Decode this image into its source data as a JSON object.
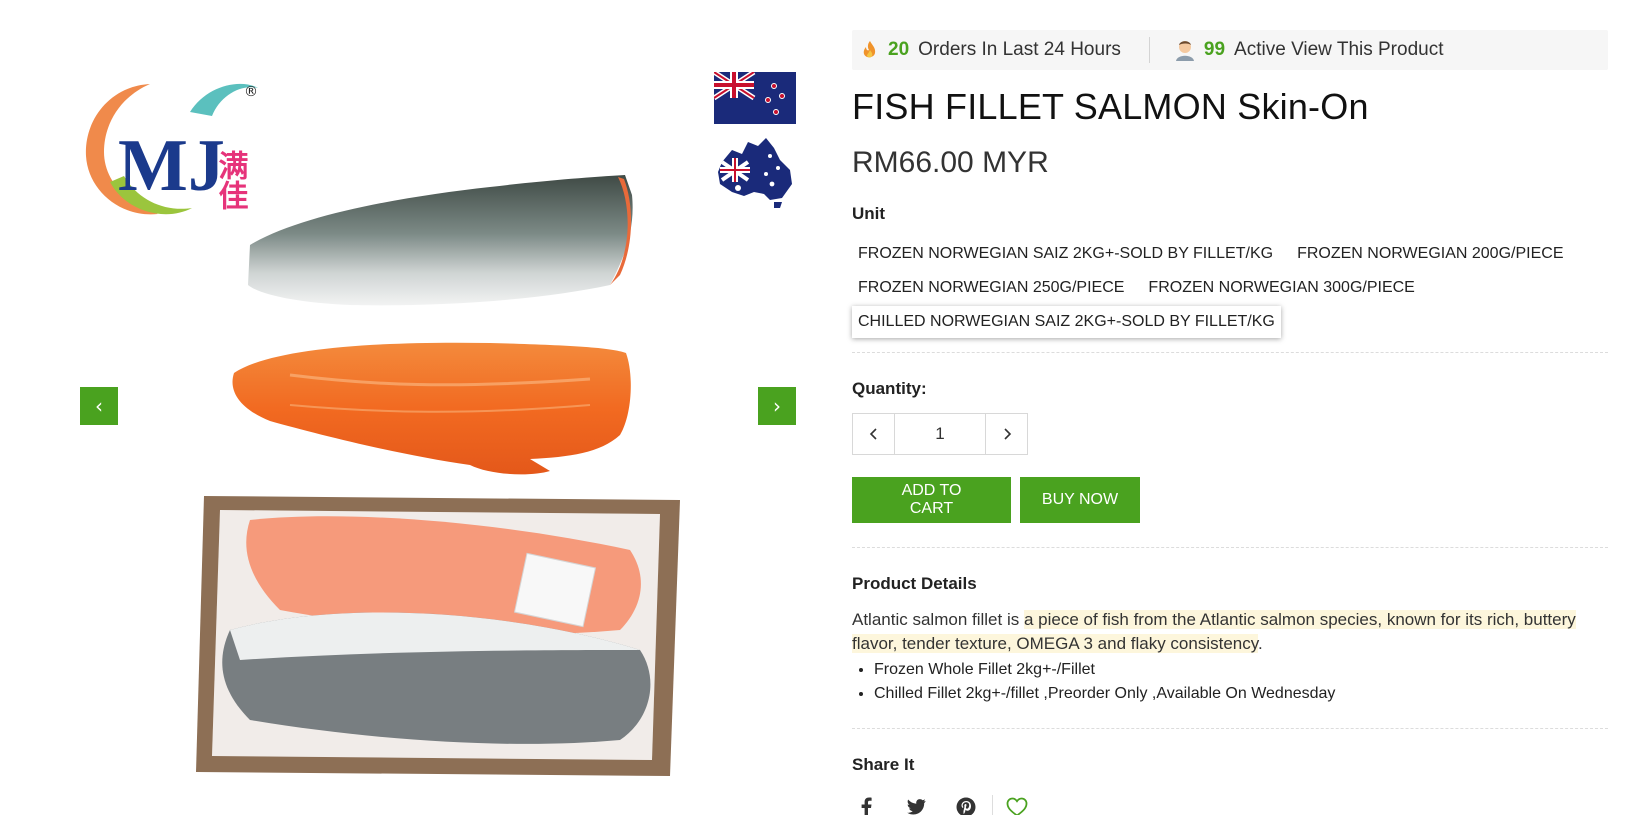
{
  "stats": {
    "orders_count": "20",
    "orders_text": "Orders In Last 24 Hours",
    "views_count": "99",
    "views_text": "Active View This Product"
  },
  "product": {
    "title": "FISH FILLET SALMON Skin-On",
    "price": "RM66.00 MYR"
  },
  "unit": {
    "label": "Unit",
    "options": [
      "FROZEN NORWEGIAN SAIZ 2KG+-SOLD BY FILLET/KG",
      "FROZEN NORWEGIAN 200G/PIECE",
      "FROZEN NORWEGIAN 250G/PIECE",
      "FROZEN NORWEGIAN 300G/PIECE",
      "CHILLED NORWEGIAN SAIZ 2KG+-SOLD BY FILLET/KG"
    ],
    "selected_index": 4
  },
  "quantity": {
    "label": "Quantity:",
    "value": "1"
  },
  "buttons": {
    "add_to_cart": "ADD TO CART",
    "buy_now": "BUY NOW"
  },
  "details": {
    "label": "Product Details",
    "intro": "Atlantic salmon fillet is",
    "highlight": "a piece of fish from the Atlantic salmon species, known for its rich, buttery flavor, tender texture, OMEGA 3 and flaky consistency",
    "end": ".",
    "bullets": [
      "Frozen Whole Fillet 2kg+-/Fillet",
      "Chilled Fillet 2kg+-/fillet ,Preorder Only ,Available On Wednesday"
    ]
  },
  "share": {
    "label": "Share It",
    "icons": [
      "facebook-icon",
      "twitter-icon",
      "pinterest-icon",
      "heart-icon"
    ]
  },
  "gallery": {
    "logo_text": "MJ",
    "logo_cn": "满佳",
    "logo_reg": "®",
    "prev_arrow": "‹",
    "next_arrow": "›"
  },
  "colors": {
    "accent": "#4aa21f",
    "highlight_bg": "#fdf6dc"
  }
}
